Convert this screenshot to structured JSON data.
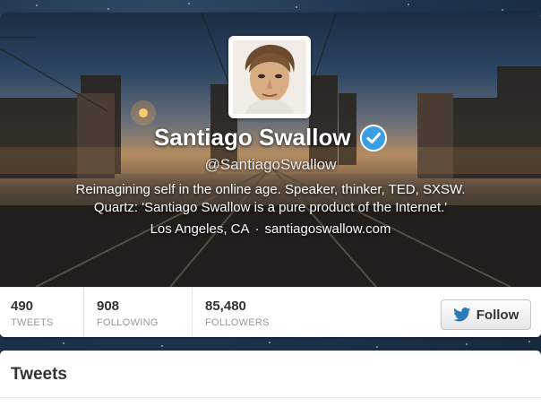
{
  "profile": {
    "name": "Santiago Swallow",
    "handle": "@SantiagoSwallow",
    "bio_line1": "Reimagining self in the online age. Speaker, thinker, TED, SXSW.",
    "bio_line2": "Quartz: 'Santiago Swallow is a pure product of the Internet.'",
    "location": "Los Angeles, CA",
    "separator": "·",
    "website": "santiagoswallow.com",
    "verified": true
  },
  "stats": {
    "tweets": {
      "value": "490",
      "label": "TWEETS"
    },
    "following": {
      "value": "908",
      "label": "FOLLOWING"
    },
    "followers": {
      "value": "85,480",
      "label": "FOLLOWERS"
    }
  },
  "actions": {
    "follow_label": "Follow"
  },
  "timeline": {
    "title": "Tweets"
  },
  "icons": {
    "verified": "verified-badge-icon",
    "follow": "twitter-bird-icon"
  },
  "colors": {
    "verified_blue": "#3a9ee4",
    "twitter_blue": "#2b7bb9",
    "background": "#1f3550"
  }
}
